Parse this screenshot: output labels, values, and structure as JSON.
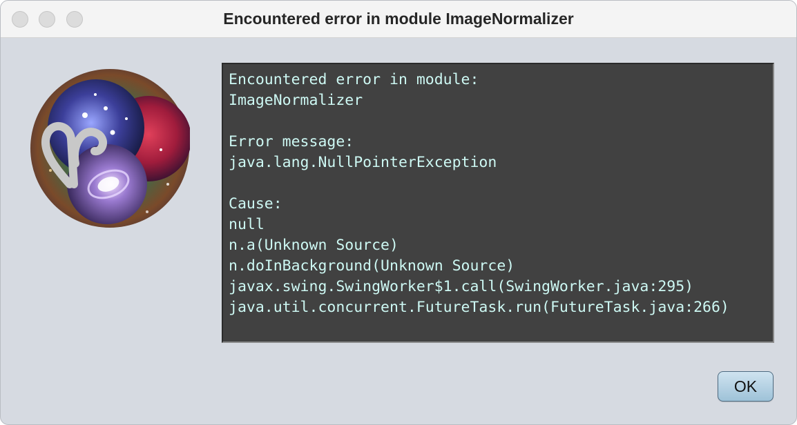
{
  "window": {
    "title": "Encountered error in module ImageNormalizer"
  },
  "logo": {
    "icon": "aries-nebula-logo-icon"
  },
  "console": {
    "lines": [
      "Encountered error in module:",
      "ImageNormalizer",
      "",
      "Error message:",
      "java.lang.NullPointerException",
      "",
      "Cause:",
      "null",
      "n.a(Unknown Source)",
      "n.doInBackground(Unknown Source)",
      "javax.swing.SwingWorker$1.call(SwingWorker.java:295)",
      "java.util.concurrent.FutureTask.run(FutureTask.java:266)"
    ]
  },
  "buttons": {
    "ok_label": "OK"
  },
  "colors": {
    "console_bg": "#414141",
    "console_text": "#cdf8f3",
    "window_bg": "#d6dae1"
  }
}
